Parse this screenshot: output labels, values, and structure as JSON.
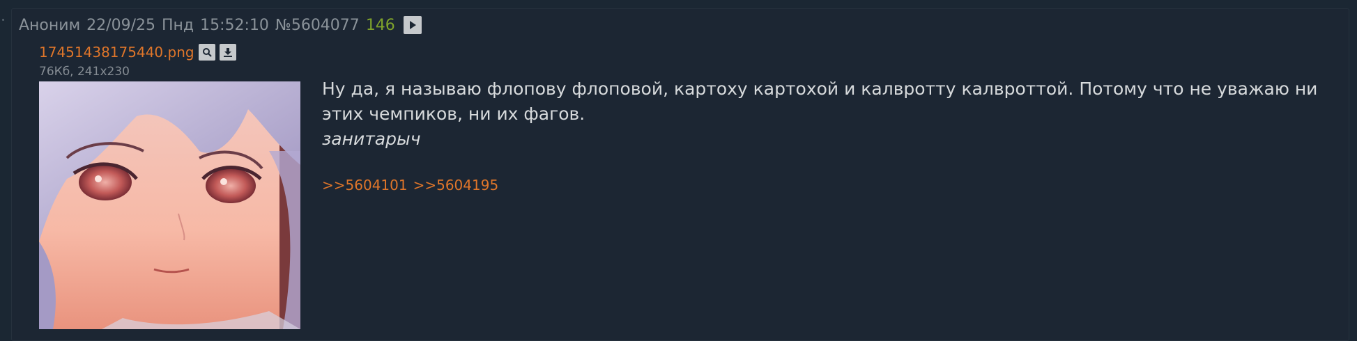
{
  "post": {
    "author": "Аноним",
    "date": "22/09/25",
    "weekday": "Пнд",
    "time": "15:52:10",
    "number": "№5604077",
    "reply_count": "146"
  },
  "file": {
    "name": "17451438175440.png",
    "meta": "76Кб, 241x230",
    "search_icon": "magnifier-icon",
    "download_icon": "download-icon"
  },
  "body": {
    "text": "Ну да, я называю флопову флоповой, картоху картохой и калвротту калвроттой. Потому что не уважаю ни этих чемпиков, ни их фагов.",
    "signature": "занитарыч"
  },
  "replies": [
    ">>5604101",
    ">>5604195"
  ],
  "colors": {
    "background": "#1c2633",
    "text": "#d7dadc",
    "meta": "#8a9299",
    "link": "#e0762a",
    "count": "#7fa32b"
  }
}
